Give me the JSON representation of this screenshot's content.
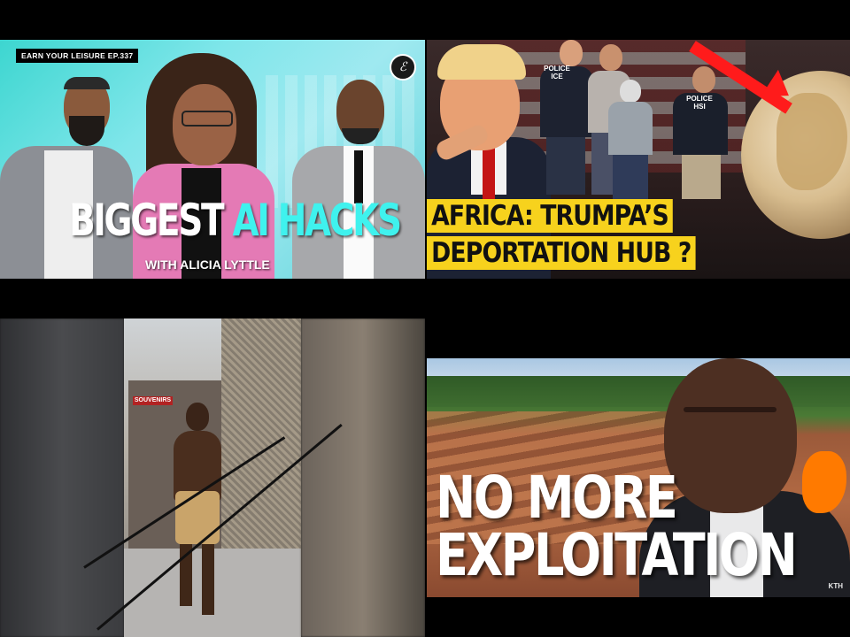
{
  "thumbnails": [
    {
      "episode_badge": "EARN YOUR LEISURE EP.337",
      "logo_glyph": "ℰ",
      "title_part1": "BIGGEST",
      "title_part2": "AI HACKS",
      "subtitle": "WITH ALICIA LYTTLE",
      "accent_color": "#3ff2ee"
    },
    {
      "caption_line1": "AFRICA: TRUMPA’S",
      "caption_line2": "DEPORTATION HUB ?",
      "vest_label_1": "POLICE ICE",
      "vest_label_2": "POLICE HSI",
      "caption_bg": "#f7d21d",
      "arrow_color": "#ff1b1b"
    },
    {
      "shop_sign": "SOUVENIRS"
    },
    {
      "title_line1": "NO MORE",
      "title_line2": "EXPLOITATION",
      "watermark": "KTH",
      "africa_color": "#ff7a00"
    }
  ]
}
